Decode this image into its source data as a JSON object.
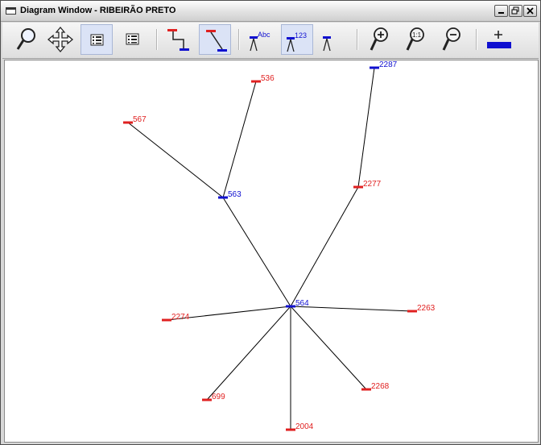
{
  "window": {
    "title": "Diagram Window - RIBEIRÃO PRETO",
    "controls": [
      "minimize",
      "restore",
      "close"
    ]
  },
  "toolbar": {
    "buttons": [
      {
        "name": "search-tool",
        "icon": "magnifier-icon",
        "active": false
      },
      {
        "name": "pan-tool",
        "icon": "move-arrows-icon",
        "active": false
      },
      {
        "name": "list-tool-1",
        "icon": "list-icon",
        "active": true
      },
      {
        "name": "list-tool-2",
        "icon": "list-icon",
        "active": false
      },
      {
        "name": "orthogonal-links",
        "icon": "orthogonal-link-icon",
        "active": false
      },
      {
        "name": "straight-links",
        "icon": "straight-link-icon",
        "active": true
      },
      {
        "name": "labels-text",
        "icon": "abc-label-icon",
        "label": "Abc",
        "active": false
      },
      {
        "name": "labels-number",
        "icon": "number-label-icon",
        "label": "123",
        "active": true
      },
      {
        "name": "labels-none",
        "icon": "no-label-icon",
        "active": false
      },
      {
        "name": "zoom-in",
        "icon": "zoom-in-icon",
        "active": false
      },
      {
        "name": "zoom-reset",
        "icon": "zoom-1to1-icon",
        "label": "1:1",
        "active": false
      },
      {
        "name": "zoom-out",
        "icon": "zoom-out-icon",
        "active": false
      },
      {
        "name": "add-node",
        "icon": "add-node-icon",
        "active": false
      }
    ]
  },
  "colors": {
    "hub_node": "#1010d0",
    "leaf_node": "#e02020",
    "edge": "#000000"
  },
  "diagram": {
    "nodes": [
      {
        "id": "536",
        "label": "536",
        "type": "leaf"
      },
      {
        "id": "567",
        "label": "567",
        "type": "leaf"
      },
      {
        "id": "563",
        "label": "563",
        "type": "hub"
      },
      {
        "id": "2287",
        "label": "2287",
        "type": "hub"
      },
      {
        "id": "2277",
        "label": "2277",
        "type": "leaf"
      },
      {
        "id": "564",
        "label": "564",
        "type": "hub"
      },
      {
        "id": "2274",
        "label": "2274",
        "type": "leaf"
      },
      {
        "id": "2263",
        "label": "2263",
        "type": "leaf"
      },
      {
        "id": "699",
        "label": "699",
        "type": "leaf"
      },
      {
        "id": "2268",
        "label": "2268",
        "type": "leaf"
      },
      {
        "id": "2004",
        "label": "2004",
        "type": "leaf"
      }
    ],
    "edges": [
      {
        "from": "563",
        "to": "536"
      },
      {
        "from": "563",
        "to": "567"
      },
      {
        "from": "563",
        "to": "564"
      },
      {
        "from": "2277",
        "to": "2287"
      },
      {
        "from": "564",
        "to": "2277"
      },
      {
        "from": "564",
        "to": "2274"
      },
      {
        "from": "564",
        "to": "2263"
      },
      {
        "from": "564",
        "to": "699"
      },
      {
        "from": "564",
        "to": "2268"
      },
      {
        "from": "564",
        "to": "2004"
      }
    ]
  }
}
